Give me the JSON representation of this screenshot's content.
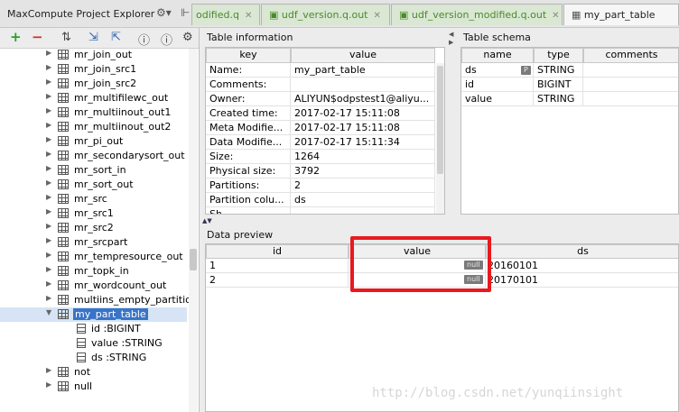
{
  "explorer": {
    "title": "MaxCompute Project Explorer",
    "toolbar_icons": [
      "add-icon",
      "remove-icon",
      "refresh-icon",
      "expand-all-icon",
      "collapse-all-icon",
      "help-icon",
      "info-icon",
      "settings-icon"
    ],
    "tree": [
      {
        "label": "mr_join_out",
        "type": "table"
      },
      {
        "label": "mr_join_src1",
        "type": "table"
      },
      {
        "label": "mr_join_src2",
        "type": "table"
      },
      {
        "label": "mr_multifilewc_out",
        "type": "table"
      },
      {
        "label": "mr_multiinout_out1",
        "type": "table"
      },
      {
        "label": "mr_multiinout_out2",
        "type": "table"
      },
      {
        "label": "mr_pi_out",
        "type": "table"
      },
      {
        "label": "mr_secondarysort_out",
        "type": "table"
      },
      {
        "label": "mr_sort_in",
        "type": "table"
      },
      {
        "label": "mr_sort_out",
        "type": "table"
      },
      {
        "label": "mr_src",
        "type": "table"
      },
      {
        "label": "mr_src1",
        "type": "table"
      },
      {
        "label": "mr_src2",
        "type": "table"
      },
      {
        "label": "mr_srcpart",
        "type": "table"
      },
      {
        "label": "mr_tempresource_out",
        "type": "table"
      },
      {
        "label": "mr_topk_in",
        "type": "table"
      },
      {
        "label": "mr_wordcount_out",
        "type": "table"
      },
      {
        "label": "multiins_empty_partitio",
        "type": "table"
      },
      {
        "label": "my_part_table",
        "type": "table",
        "selected": true,
        "expanded": true
      },
      {
        "label": "id :BIGINT",
        "type": "column"
      },
      {
        "label": "value :STRING",
        "type": "column"
      },
      {
        "label": "ds :STRING",
        "type": "partition"
      },
      {
        "label": "not",
        "type": "table"
      },
      {
        "label": "null",
        "type": "table"
      }
    ]
  },
  "tabs": [
    {
      "label": "odified.q"
    },
    {
      "label": "udf_version.q.out"
    },
    {
      "label": "udf_version_modified.q.out"
    },
    {
      "label": "my_part_table",
      "active": true
    }
  ],
  "table_info": {
    "title": "Table information",
    "col_key": "key",
    "col_value": "value",
    "rows": [
      {
        "key": "Name:",
        "value": "my_part_table"
      },
      {
        "key": "Comments:",
        "value": ""
      },
      {
        "key": "Owner:",
        "value": "ALIYUN$odpstest1@aliyu..."
      },
      {
        "key": "Created time:",
        "value": "2017-02-17 15:11:08"
      },
      {
        "key": "Meta Modifie...",
        "value": "2017-02-17 15:11:08"
      },
      {
        "key": "Data Modifie...",
        "value": "2017-02-17 15:11:34"
      },
      {
        "key": "Size:",
        "value": "1264"
      },
      {
        "key": "Physical size:",
        "value": "3792"
      },
      {
        "key": "Partitions:",
        "value": "2"
      },
      {
        "key": "Partition colu...",
        "value": "ds"
      },
      {
        "key": "Sh...",
        "value": ""
      }
    ]
  },
  "schema": {
    "title": "Table schema",
    "col_name": "name",
    "col_type": "type",
    "col_comments": "comments",
    "partition_marker": "P",
    "rows": [
      {
        "name": "ds",
        "type": "STRING",
        "comments": "",
        "partition": true
      },
      {
        "name": "id",
        "type": "BIGINT",
        "comments": ""
      },
      {
        "name": "value",
        "type": "STRING",
        "comments": ""
      }
    ]
  },
  "preview": {
    "title": "Data preview",
    "col_id": "id",
    "col_value": "value",
    "col_ds": "ds",
    "null_label": "null",
    "rows": [
      {
        "id": "1",
        "ds": "20160101"
      },
      {
        "id": "2",
        "ds": "20170101"
      }
    ]
  },
  "watermark": "http://blog.csdn.net/yunqiinsight",
  "colors": {
    "highlight": "#e8191f",
    "selection": "#3874c8",
    "tab_active_bg": "#f6f6f6"
  }
}
